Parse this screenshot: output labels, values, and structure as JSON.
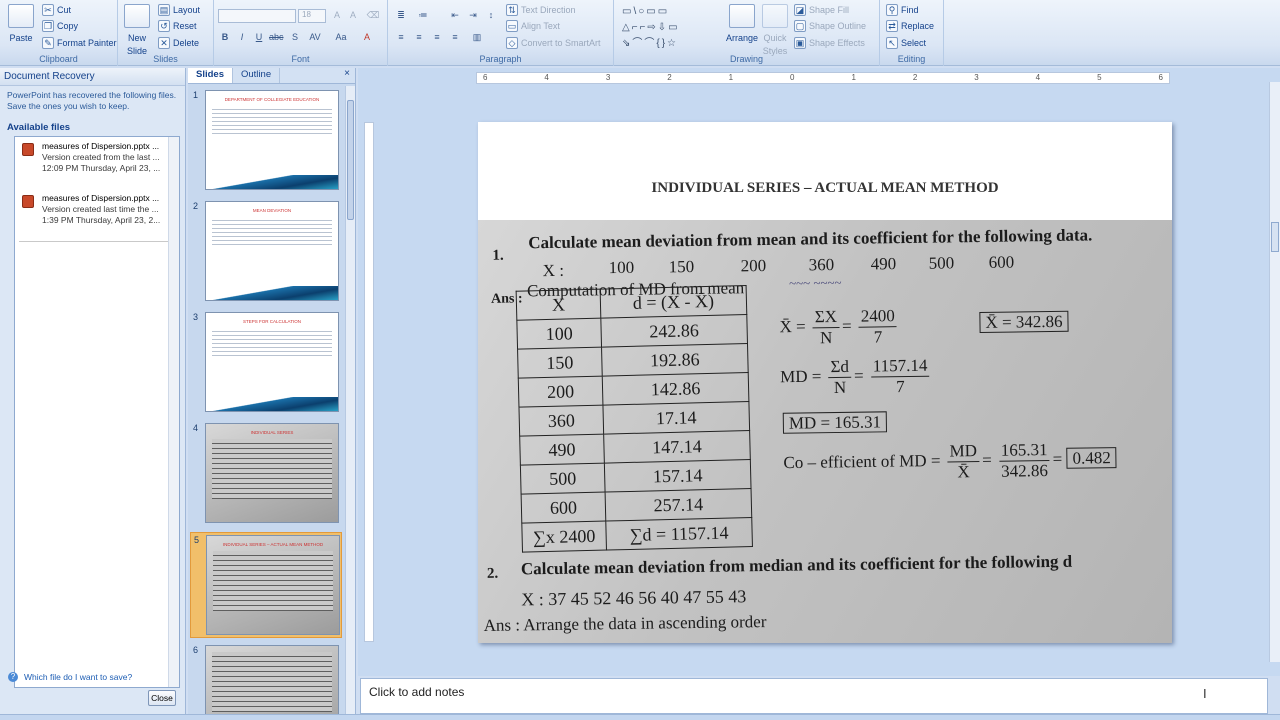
{
  "ribbon": {
    "clipboard": {
      "label": "Clipboard",
      "paste": "Paste",
      "cut": "Cut",
      "copy": "Copy",
      "format_painter": "Format Painter"
    },
    "slides": {
      "label": "Slides",
      "new_slide_line1": "New",
      "new_slide_line2": "Slide",
      "layout": "Layout",
      "reset": "Reset",
      "delete": "Delete"
    },
    "font": {
      "label": "Font",
      "size": "18"
    },
    "paragraph": {
      "label": "Paragraph",
      "text_direction": "Text Direction",
      "align_text": "Align Text",
      "convert_smartart": "Convert to SmartArt"
    },
    "drawing": {
      "label": "Drawing",
      "arrange": "Arrange",
      "quick_styles_line1": "Quick",
      "quick_styles_line2": "Styles",
      "shape_fill": "Shape Fill",
      "shape_outline": "Shape Outline",
      "shape_effects": "Shape Effects"
    },
    "editing": {
      "label": "Editing",
      "find": "Find",
      "replace": "Replace",
      "select": "Select"
    }
  },
  "recovery": {
    "title": "Document Recovery",
    "message": "PowerPoint has recovered the following files. Save the ones you wish to keep.",
    "available_label": "Available files",
    "files": [
      {
        "name": "measures of Dispersion.pptx ...",
        "line2": "Version created from the last ...",
        "line3": "12:09 PM Thursday, April 23, ..."
      },
      {
        "name": "measures of Dispersion.pptx ...",
        "line2": "Version created last time the ...",
        "line3": "1:39 PM Thursday, April 23, 2..."
      }
    ],
    "help_link": "Which file do I want to save?",
    "close_label": "Close"
  },
  "slides_pane": {
    "tab_slides": "Slides",
    "tab_outline": "Outline",
    "close": "×",
    "thumbnails": [
      {
        "number": "1",
        "title": "DEPARTMENT OF COLLEGIATE EDUCATION",
        "style": "text"
      },
      {
        "number": "2",
        "title": "MEAN DEVIATION",
        "style": "text"
      },
      {
        "number": "3",
        "title": "STEPS FOR CALCULATION",
        "style": "text"
      },
      {
        "number": "4",
        "title": "INDIVIDUAL SERIES",
        "style": "photo"
      },
      {
        "number": "5",
        "title": "INDIVIDUAL SERIES – ACTUAL MEAN METHOD",
        "style": "photo"
      },
      {
        "number": "6",
        "title": "",
        "style": "photo"
      }
    ],
    "selected_index": 4
  },
  "ruler": {
    "ticks": [
      "6",
      "4",
      "3",
      "2",
      "1",
      "0",
      "1",
      "2",
      "3",
      "4",
      "5",
      "6"
    ]
  },
  "slide": {
    "title": "INDIVIDUAL SERIES – ACTUAL MEAN METHOD",
    "q1_number": "1.",
    "q1_text": "Calculate mean deviation from mean and its coefficient for the following data.",
    "x_label": "X :",
    "x_values": [
      "100",
      "150",
      "200",
      "360",
      "490",
      "500",
      "600"
    ],
    "ans_label": "Ans :",
    "computation": "Computation of MD from mean",
    "table": {
      "headers": [
        "X",
        "d = (X - X̄)"
      ],
      "rows": [
        [
          "100",
          "242.86"
        ],
        [
          "150",
          "192.86"
        ],
        [
          "200",
          "142.86"
        ],
        [
          "360",
          "17.14"
        ],
        [
          "490",
          "147.14"
        ],
        [
          "500",
          "157.14"
        ],
        [
          "600",
          "257.14"
        ]
      ],
      "totals": [
        "∑x 2400",
        "∑d = 1157.14"
      ]
    },
    "mean_formula": {
      "lhs": "X̄ =",
      "num1": "ΣX",
      "den1": "N",
      "num2": "2400",
      "den2": "7"
    },
    "mean_result": "X̄ = 342.86",
    "md_formula": {
      "lhs": "MD =",
      "num1": "Σd",
      "den1": "N",
      "num2": "1157.14",
      "den2": "7"
    },
    "md_result": "MD = 165.31",
    "coef_formula": {
      "lhs": "Co – efficient of MD =",
      "num1": "MD",
      "den1": "X̄",
      "num2": "165.31",
      "den2": "342.86",
      "result": "0.482"
    },
    "q2_number": "2.",
    "q2_text": "Calculate mean deviation from median and its coefficient for the following d",
    "q2_values": "X : 37   45   52   46   56   40   47   55   43",
    "q2_ans": "Ans : Arrange the data in ascending order"
  },
  "notes": {
    "placeholder": "Click to add notes"
  }
}
